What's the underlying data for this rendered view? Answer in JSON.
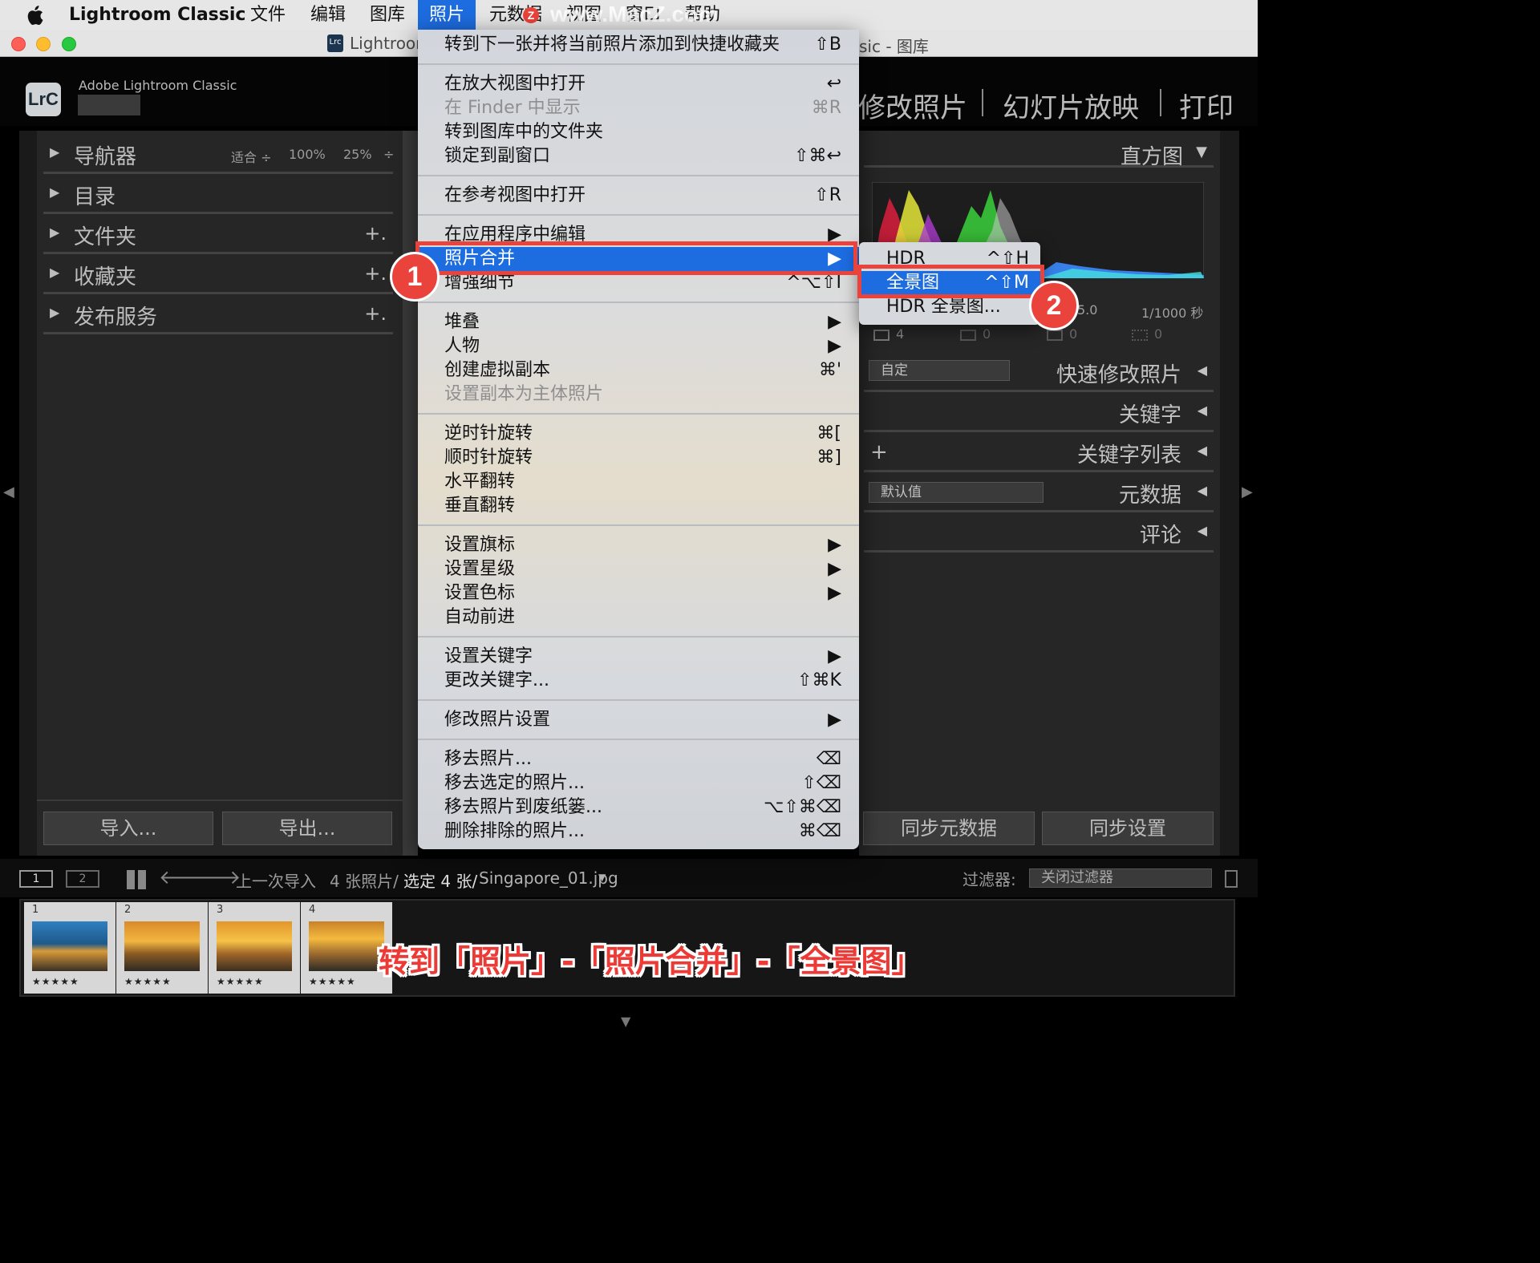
{
  "menubar": {
    "app_name": "Lightroom Classic",
    "items": [
      "文件",
      "编辑",
      "图库",
      "照片",
      "元数据",
      "视图",
      "窗口",
      "帮助"
    ],
    "active_item": "照片"
  },
  "watermark": "www.MacZ.com",
  "window": {
    "title_left": "Lightroom",
    "title_right": "sic - 图库"
  },
  "identity": {
    "brand": "Adobe Lightroom Classic",
    "logo": "LrC"
  },
  "modules": [
    "修改照片",
    "幻灯片放映",
    "打印"
  ],
  "left_panel": {
    "navigator": {
      "label": "导航器",
      "fit": "适合 ÷",
      "zoom1": "100%",
      "zoom2": "25%",
      "stepper": "÷"
    },
    "items": [
      {
        "label": "目录",
        "plus": ""
      },
      {
        "label": "文件夹",
        "plus": "+."
      },
      {
        "label": "收藏夹",
        "plus": "+."
      },
      {
        "label": "发布服务",
        "plus": "+."
      }
    ],
    "import_button": "导入...",
    "export_button": "导出..."
  },
  "right_panel": {
    "histogram_label": "直方图",
    "exif_aperture": "5.0",
    "exif_shutter": "1/1000 秒",
    "counts": [
      "4",
      "0",
      "0",
      "0"
    ],
    "quick_develop": {
      "preset": "自定",
      "label": "快速修改照片"
    },
    "keywords": "关键字",
    "keyword_list": "关键字列表",
    "metadata": {
      "preset": "默认值",
      "label": "元数据"
    },
    "comments": "评论",
    "sync_metadata": "同步元数据",
    "sync_settings": "同步设置"
  },
  "menu": {
    "items": [
      {
        "label": "转到下一张并将当前照片添加到快捷收藏夹",
        "shortcut": "⇧B"
      },
      {
        "label": "在放大视图中打开",
        "shortcut": "↩"
      },
      {
        "label": "在 Finder 中显示",
        "shortcut": "⌘R"
      },
      {
        "label": "转到图库中的文件夹",
        "shortcut": ""
      },
      {
        "label": "锁定到副窗口",
        "shortcut": "⇧⌘↩"
      },
      {
        "label": "在参考视图中打开",
        "shortcut": "⇧R"
      },
      {
        "label": "在应用程序中编辑",
        "shortcut": "▶"
      },
      {
        "label": "照片合并",
        "shortcut": "▶"
      },
      {
        "label": "增强细节",
        "shortcut": "^⌥⇧I"
      },
      {
        "label": "堆叠",
        "shortcut": "▶"
      },
      {
        "label": "人物",
        "shortcut": "▶"
      },
      {
        "label": "创建虚拟副本",
        "shortcut": "⌘'"
      },
      {
        "label": "设置副本为主体照片",
        "shortcut": ""
      },
      {
        "label": "逆时针旋转",
        "shortcut": "⌘["
      },
      {
        "label": "顺时针旋转",
        "shortcut": "⌘]"
      },
      {
        "label": "水平翻转",
        "shortcut": ""
      },
      {
        "label": "垂直翻转",
        "shortcut": ""
      },
      {
        "label": "设置旗标",
        "shortcut": "▶"
      },
      {
        "label": "设置星级",
        "shortcut": "▶"
      },
      {
        "label": "设置色标",
        "shortcut": "▶"
      },
      {
        "label": "自动前进",
        "shortcut": ""
      },
      {
        "label": "设置关键字",
        "shortcut": "▶"
      },
      {
        "label": "更改关键字...",
        "shortcut": "⇧⌘K"
      },
      {
        "label": "修改照片设置",
        "shortcut": "▶"
      },
      {
        "label": "移去照片...",
        "shortcut": "⌫"
      },
      {
        "label": "移去选定的照片...",
        "shortcut": "⇧⌫"
      },
      {
        "label": "移去照片到废纸篓...",
        "shortcut": "⌥⇧⌘⌫"
      },
      {
        "label": "删除排除的照片...",
        "shortcut": "⌘⌫"
      }
    ]
  },
  "submenu": {
    "items": [
      {
        "label": "HDR",
        "shortcut": "^⇧H"
      },
      {
        "label": "全景图",
        "shortcut": "^⇧M"
      },
      {
        "label": "HDR 全景图...",
        "shortcut": ""
      }
    ]
  },
  "badges": [
    "1",
    "2"
  ],
  "filmstrip_bar": {
    "view1": "1",
    "view2": "2",
    "source": "上一次导入",
    "count": "4 张照片/",
    "selected": "选定 4 张/",
    "filename": "Singapore_01.jpg",
    "filter_label": "过滤器:",
    "filter_value": "关闭过滤器"
  },
  "thumbs": [
    {
      "num": "1",
      "stars": "★★★★★"
    },
    {
      "num": "2",
      "stars": "★★★★★"
    },
    {
      "num": "3",
      "stars": "★★★★★"
    },
    {
      "num": "4",
      "stars": "★★★★★"
    }
  ],
  "caption": "转到「照片」-「照片合并」-「全景图」",
  "colors": {
    "accent": "#1d6ce0",
    "annotation_red": "#e9433c"
  }
}
